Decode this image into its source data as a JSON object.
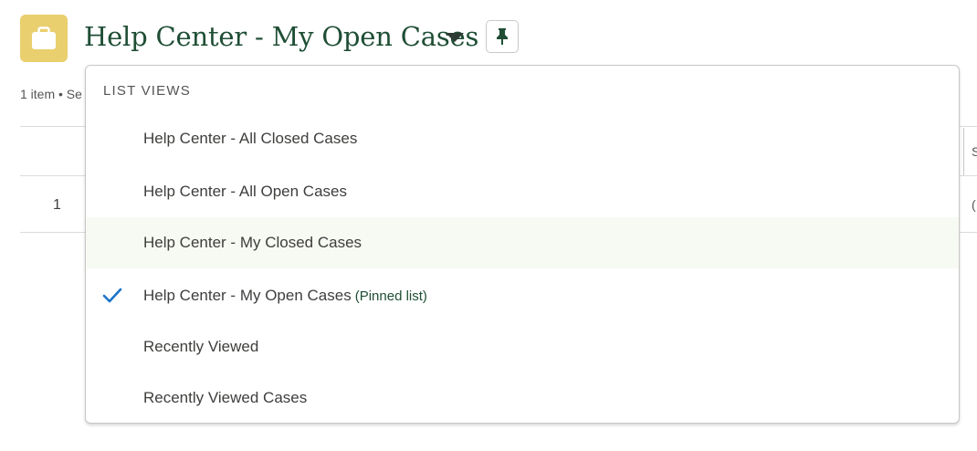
{
  "header": {
    "title": "Help Center - My Open Cases",
    "app_icon": "briefcase-icon",
    "pin_icon": "pin-icon",
    "accent_color": "#1f4e35",
    "icon_bg_color": "#e9cf6e"
  },
  "list": {
    "item_count": "1 item • Se",
    "row_number": "1",
    "column_peek": "S",
    "cell_peek": "("
  },
  "dropdown": {
    "header": "LIST VIEWS",
    "items": [
      {
        "label": "Help Center - All Closed Cases",
        "selected": false
      },
      {
        "label": "Help Center - All Open Cases",
        "selected": false
      },
      {
        "label": "Help Center - My Closed Cases",
        "selected": false,
        "hovered": true
      },
      {
        "label": "Help Center - My Open Cases",
        "selected": true,
        "tag": "(Pinned list)"
      },
      {
        "label": "Recently Viewed",
        "selected": false
      },
      {
        "label": "Recently Viewed Cases",
        "selected": false
      }
    ],
    "check_color": "#1b74c9"
  }
}
